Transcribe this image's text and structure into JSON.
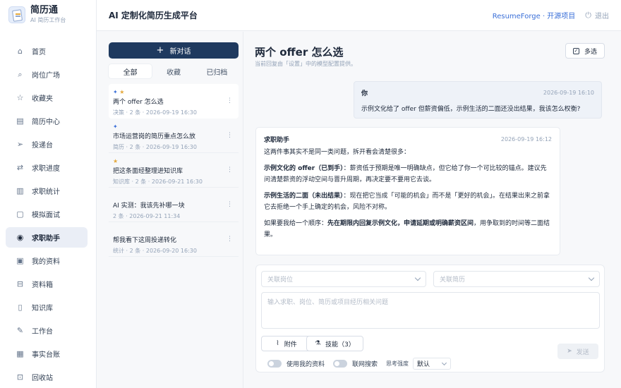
{
  "brand": {
    "name": "简历通",
    "subtitle": "AI 简历工作台"
  },
  "header": {
    "title": "AI 定制化简历生成平台",
    "link": "ResumeForge · 开源项目",
    "logout": "退出"
  },
  "sidebar": {
    "items": [
      {
        "label": "首页",
        "icon": "home-icon",
        "glyph": "⌂"
      },
      {
        "label": "岗位广场",
        "icon": "search-icon",
        "glyph": "⌕"
      },
      {
        "label": "收藏夹",
        "icon": "star-icon",
        "glyph": "☆"
      },
      {
        "label": "简历中心",
        "icon": "document-icon",
        "glyph": "▤"
      },
      {
        "label": "投递台",
        "icon": "send-icon",
        "glyph": "➢"
      },
      {
        "label": "求职进度",
        "icon": "progress-icon",
        "glyph": "⇄"
      },
      {
        "label": "求职统计",
        "icon": "chart-icon",
        "glyph": "▥"
      },
      {
        "label": "模拟面试",
        "icon": "interview-icon",
        "glyph": "▢"
      },
      {
        "label": "求职助手",
        "icon": "chat-icon",
        "glyph": "◉",
        "active": true
      },
      {
        "label": "我的资料",
        "icon": "profile-icon",
        "glyph": "▣"
      },
      {
        "label": "资料箱",
        "icon": "box-icon",
        "glyph": "⊟"
      },
      {
        "label": "知识库",
        "icon": "book-icon",
        "glyph": "▯"
      },
      {
        "label": "工作台",
        "icon": "wrench-icon",
        "glyph": "✎"
      },
      {
        "label": "事实台账",
        "icon": "ledger-icon",
        "glyph": "▦"
      },
      {
        "label": "回收站",
        "icon": "trash-icon",
        "glyph": "⊡"
      }
    ]
  },
  "conversations": {
    "new_label": "新对话",
    "tabs": [
      "全部",
      "收藏",
      "已归档"
    ],
    "items": [
      {
        "title": "两个 offer 怎么选",
        "meta": "决策 · 2 条 · 2026-09-19 16:30",
        "pinned": true,
        "starred": true,
        "active": true
      },
      {
        "title": "市场运营岗的简历重点怎么放",
        "meta": "简历 · 2 条 · 2026-09-19 16:30",
        "pinned": true,
        "starred": false
      },
      {
        "title": "把这条面经整理进知识库",
        "meta": "知识库 · 2 条 · 2026-09-21 16:30",
        "pinned": false,
        "starred": true
      },
      {
        "title": "AI 实测：我该先补哪一块",
        "meta": "2 条 · 2026-09-21 11:34",
        "pinned": false,
        "starred": false
      },
      {
        "title": "帮我看下这周投递转化",
        "meta": "统计 · 2 条 · 2026-09-20 16:30",
        "pinned": false,
        "starred": false
      }
    ]
  },
  "chat": {
    "title": "两个 offer 怎么选",
    "subtitle": "当前回复由「设置」中的模型配置提供。",
    "multi_select": "多选",
    "user_msg": {
      "name": "你",
      "time": "2026-09-19 16:10",
      "text": "示例文化给了 offer 但薪资偏低，示例生活的二面还没出结果，我该怎么权衡?"
    },
    "bot_msg": {
      "name": "求职助手",
      "time": "2026-09-19 16:12",
      "intro": "这两件事其实不是同一类问题，拆开看会清楚很多：",
      "p1_bold": "示例文化的 offer（已到手）",
      "p1_text": "：薪资低于预期是唯一明确缺点，但它给了你一个可比较的锚点。建议先问清楚薪资的浮动空间与晋升周期，再决定要不要用它去谈。",
      "p2_bold": "示例生活的二面（未出结果）",
      "p2_text": "：现在把它当成「可能的机会」而不是「更好的机会」。在结果出来之前拿它去拒绝一个手上确定的机会，风险不对称。",
      "p3_text1": "如果要我给一个顺序：",
      "p3_bold": "先在期限内回复示例文化，申请延期或明确薪资区间",
      "p3_text2": "，用争取到的时间等二面结果。"
    }
  },
  "composer": {
    "job_placeholder": "关联岗位",
    "resume_placeholder": "关联简历",
    "input_placeholder": "输入求职、岗位、简历或项目经历相关问题",
    "attach_label": "附件",
    "skill_label": "技能（3）",
    "send_label": "发送",
    "use_profile_label": "使用我的资料",
    "web_search_label": "联网搜索",
    "depth_label": "思考强度",
    "depth_value": "默认"
  }
}
